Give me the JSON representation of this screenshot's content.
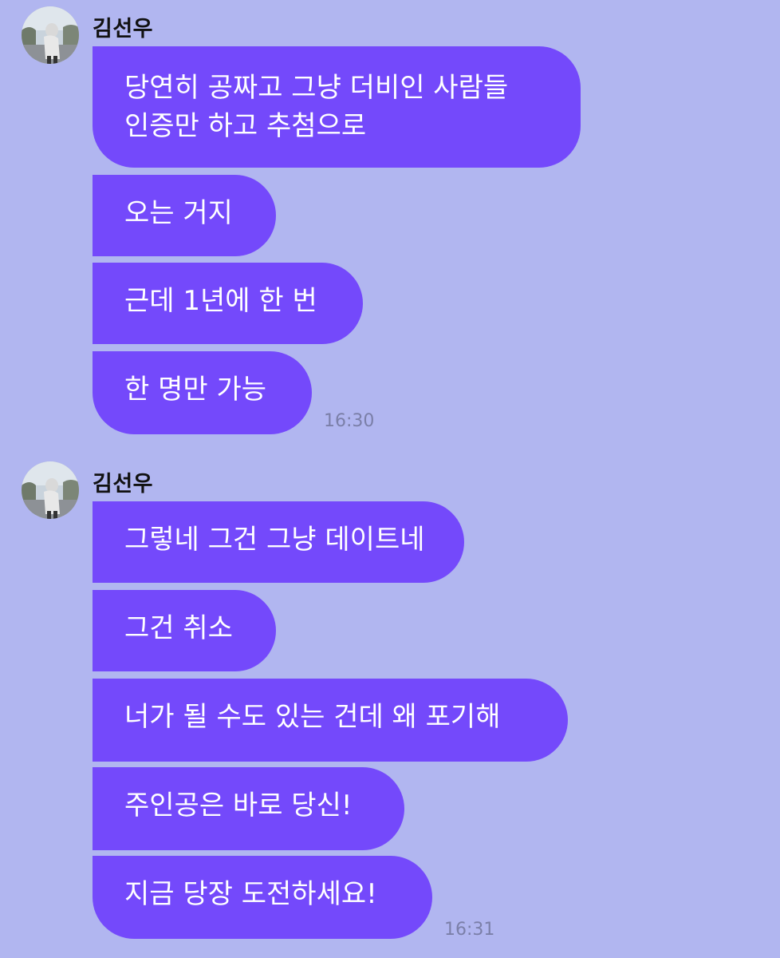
{
  "groups": [
    {
      "sender": "김선우",
      "messages": [
        "당연히 공짜고 그냥 더비인 사람들\n인증만 하고 추첨으로",
        "오는 거지",
        "근데 1년에 한 번",
        "한 명만 가능"
      ],
      "time": "16:30"
    },
    {
      "sender": "김선우",
      "messages": [
        "그렇네 그건 그냥 데이트네",
        "그건 취소",
        "너가 될 수도 있는 건데 왜 포기해",
        "주인공은 바로 당신!",
        "지금 당장 도전하세요!"
      ],
      "time": "16:31"
    }
  ],
  "colors": {
    "background": "#b1b6f0",
    "bubble": "#7449fb",
    "bubble_text": "#ffffff",
    "timestamp": "#7b7fa8"
  },
  "icons": [
    "avatar-photo"
  ]
}
